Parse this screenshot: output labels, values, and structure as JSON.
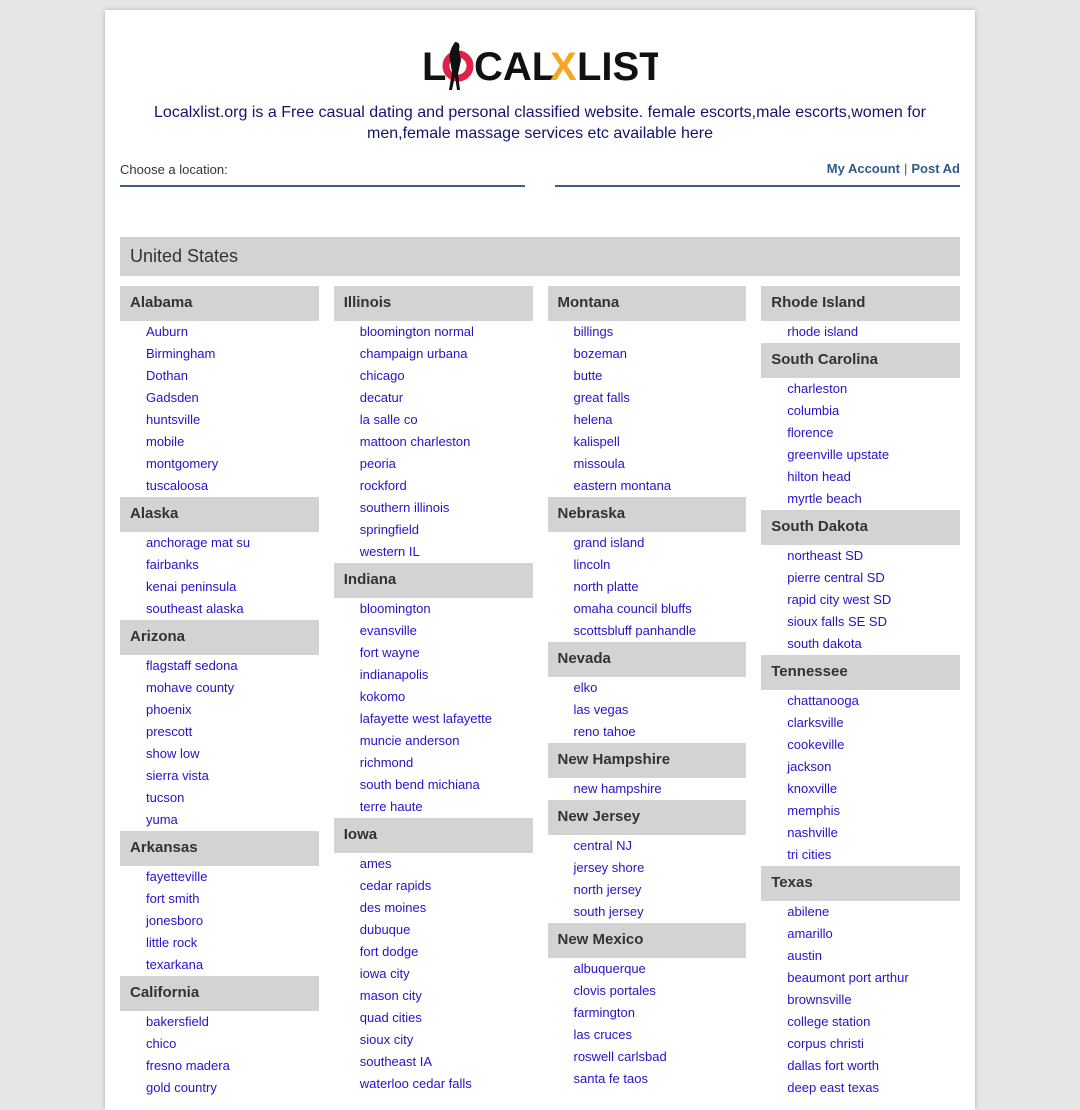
{
  "logo": {
    "text": "LOCALXLIST",
    "colors": {
      "main": "#111111",
      "o": "#e0224a",
      "x": "#f5a623"
    }
  },
  "description": "Localxlist.org is a Free casual dating and personal classified website. female escorts,male escorts,women for men,female massage services etc available here",
  "location_label": "Choose a location:",
  "my_account": "My Account",
  "separator": "|",
  "post_ad": "Post Ad",
  "country": "United States",
  "columns": [
    [
      {
        "state": "Alabama",
        "cities": [
          "Auburn",
          "Birmingham",
          "Dothan",
          "Gadsden",
          "huntsville",
          "mobile",
          "montgomery",
          "tuscaloosa"
        ]
      },
      {
        "state": "Alaska",
        "cities": [
          "anchorage mat su",
          "fairbanks",
          "kenai peninsula",
          "southeast alaska"
        ]
      },
      {
        "state": "Arizona",
        "cities": [
          "flagstaff sedona",
          "mohave county",
          "phoenix",
          "prescott",
          "show low",
          "sierra vista",
          "tucson",
          "yuma"
        ]
      },
      {
        "state": "Arkansas",
        "cities": [
          "fayetteville",
          "fort smith",
          "jonesboro",
          "little rock",
          "texarkana"
        ]
      },
      {
        "state": "California",
        "cities": [
          "bakersfield",
          "chico",
          "fresno madera",
          "gold country"
        ]
      }
    ],
    [
      {
        "state": "Illinois",
        "cities": [
          "bloomington normal",
          "champaign urbana",
          "chicago",
          "decatur",
          "la salle co",
          "mattoon charleston",
          "peoria",
          "rockford",
          "southern illinois",
          "springfield",
          "western IL"
        ]
      },
      {
        "state": "Indiana",
        "cities": [
          "bloomington",
          "evansville",
          "fort wayne",
          "indianapolis",
          "kokomo",
          "lafayette west lafayette",
          "muncie anderson",
          "richmond",
          "south bend michiana",
          "terre haute"
        ]
      },
      {
        "state": "Iowa",
        "cities": [
          "ames",
          "cedar rapids",
          "des moines",
          "dubuque",
          "fort dodge",
          "iowa city",
          "mason city",
          "quad cities",
          "sioux city",
          "southeast IA",
          "waterloo cedar falls"
        ]
      }
    ],
    [
      {
        "state": "Montana",
        "cities": [
          "billings",
          "bozeman",
          "butte",
          "great falls",
          "helena",
          "kalispell",
          "missoula",
          "eastern montana"
        ]
      },
      {
        "state": "Nebraska",
        "cities": [
          "grand island",
          "lincoln",
          "north platte",
          "omaha council bluffs",
          "scottsbluff panhandle"
        ]
      },
      {
        "state": "Nevada",
        "cities": [
          "elko",
          "las vegas",
          "reno tahoe"
        ]
      },
      {
        "state": "New Hampshire",
        "cities": [
          "new hampshire"
        ]
      },
      {
        "state": "New Jersey",
        "cities": [
          "central NJ",
          "jersey shore",
          "north jersey",
          "south jersey"
        ]
      },
      {
        "state": "New Mexico",
        "cities": [
          "albuquerque",
          "clovis portales",
          "farmington",
          "las cruces",
          "roswell carlsbad",
          "santa fe taos"
        ]
      }
    ],
    [
      {
        "state": "Rhode Island",
        "cities": [
          "rhode island"
        ]
      },
      {
        "state": "South Carolina",
        "cities": [
          "charleston",
          "columbia",
          "florence",
          "greenville upstate",
          "hilton head",
          "myrtle beach"
        ]
      },
      {
        "state": "South Dakota",
        "cities": [
          "northeast SD",
          "pierre central SD",
          "rapid city west SD",
          "sioux falls SE SD",
          "south dakota"
        ]
      },
      {
        "state": "Tennessee",
        "cities": [
          "chattanooga",
          "clarksville",
          "cookeville",
          "jackson",
          "knoxville",
          "memphis",
          "nashville",
          "tri cities"
        ]
      },
      {
        "state": "Texas",
        "cities": [
          "abilene",
          "amarillo",
          "austin",
          "beaumont port arthur",
          "brownsville",
          "college station",
          "corpus christi",
          "dallas fort worth",
          "deep east texas"
        ]
      }
    ]
  ]
}
